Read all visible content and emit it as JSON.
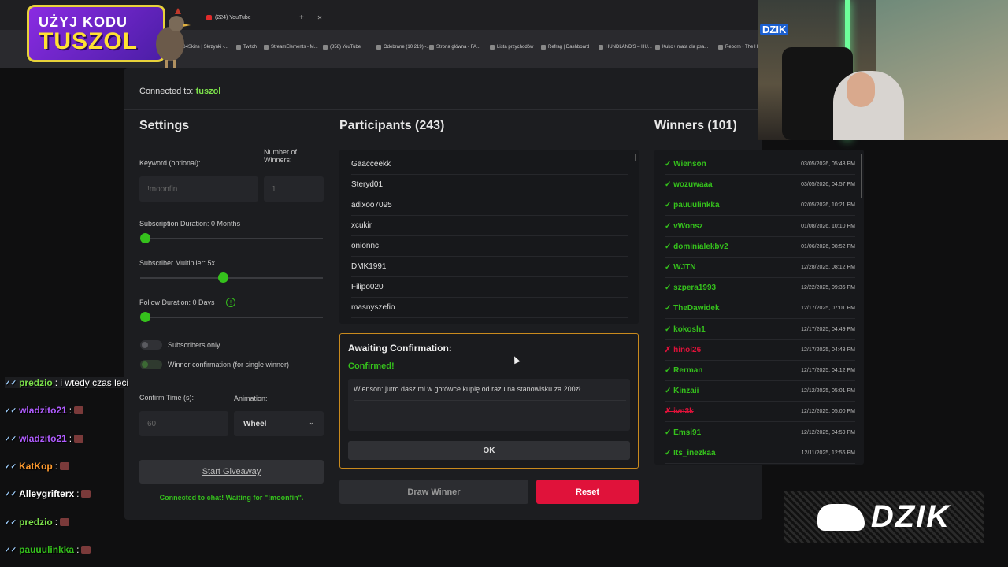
{
  "browser": {
    "tabs": [
      {
        "label": ""
      },
      {
        "label": "(224) YouTube"
      }
    ],
    "new_tab": "+",
    "bookmarks": [
      "G4Skins | Skrzynki -...",
      "Twitch",
      "StreamElements - M...",
      "(358) YouTube",
      "Odebrane (10 219) -...",
      "Strona główna - FA...",
      "Lista przychodów",
      "Refrag | Dashboard",
      "HUNDLAND'S – HU...",
      "Kuko+ mata dla psa...",
      "Reborn • The Ho"
    ]
  },
  "promo": {
    "line1": "UŻYJ KODU",
    "line2": "TUSZOL"
  },
  "app": {
    "connected_prefix": "Connected to:",
    "channel": "tuszol",
    "settings": {
      "title": "Settings",
      "keyword_label": "Keyword (optional):",
      "keyword_value": "!moonfin",
      "winners_label_1": "Number of",
      "winners_label_2": "Winners:",
      "winners_value": "1",
      "sub_duration_label": "Subscription Duration: 0 Months",
      "sub_duration_fraction": 0.0,
      "multiplier_label": "Subscriber Multiplier: 5x",
      "multiplier_fraction": 0.45,
      "follow_label": "Follow Duration: 0 Days",
      "follow_fraction": 0.0,
      "info_icon": "!",
      "subs_only_label": "Subscribers only",
      "winner_confirm_label": "Winner confirmation (for single winner)",
      "confirm_time_label": "Confirm Time (s):",
      "confirm_time_value": "60",
      "animation_label": "Animation:",
      "animation_value": "Wheel",
      "start_button": "Start Giveaway",
      "status": "Connected to chat! Waiting for \"!moonfin\"."
    },
    "participants": {
      "title": "Participants (243)",
      "items": [
        "Gaacceekk",
        "Steryd01",
        "adixoo7095",
        "xcukir",
        "onionnc",
        "DMK1991",
        "Filipo020",
        "masnyszefio"
      ]
    },
    "confirmation": {
      "title": "Awaiting Confirmation:",
      "status": "Confirmed!",
      "message": "Wienson: jutro dasz mi w gotówce kupię od razu na stanowisku za 200zł",
      "ok_button": "OK"
    },
    "draw_button": "Draw Winner",
    "reset_button": "Reset",
    "winners": {
      "title": "Winners (101)",
      "items": [
        {
          "name": "✓ Wienson",
          "date": "03/05/2026, 05:48 PM",
          "rejected": false
        },
        {
          "name": "✓ wozuwaaa",
          "date": "03/05/2026, 04:57 PM",
          "rejected": false
        },
        {
          "name": "✓ pauuulinkka",
          "date": "02/05/2026, 10:21 PM",
          "rejected": false
        },
        {
          "name": "✓ vWonsz",
          "date": "01/08/2026, 10:10 PM",
          "rejected": false
        },
        {
          "name": "✓ dominialekbv2",
          "date": "01/06/2026, 08:52 PM",
          "rejected": false
        },
        {
          "name": "✓ WJTN",
          "date": "12/28/2025, 08:12 PM",
          "rejected": false
        },
        {
          "name": "✓ szpera1993",
          "date": "12/22/2025, 09:36 PM",
          "rejected": false
        },
        {
          "name": "✓ TheDawidek",
          "date": "12/17/2025, 07:01 PM",
          "rejected": false
        },
        {
          "name": "✓ kokosh1",
          "date": "12/17/2025, 04:49 PM",
          "rejected": false
        },
        {
          "name": "✗ hinoi26",
          "date": "12/17/2025, 04:48 PM",
          "rejected": true
        },
        {
          "name": "✓ Rerman",
          "date": "12/17/2025, 04:12 PM",
          "rejected": false
        },
        {
          "name": "✓ Kinzaii",
          "date": "12/12/2025, 05:01 PM",
          "rejected": false
        },
        {
          "name": "✗ ivn3k",
          "date": "12/12/2025, 05:00 PM",
          "rejected": true
        },
        {
          "name": "✓ Emsi91",
          "date": "12/12/2025, 04:59 PM",
          "rejected": false
        },
        {
          "name": "✓ Its_inezkaa",
          "date": "12/11/2025, 12:56 PM",
          "rejected": false
        }
      ]
    }
  },
  "chat": [
    {
      "user": "predzio",
      "text": ": i wtedy czas leci",
      "color": "#7be04a"
    },
    {
      "user": "wladzito21",
      "text": ":",
      "color": "#b05cff"
    },
    {
      "user": "wladzito21",
      "text": ":",
      "color": "#b05cff"
    },
    {
      "user": "KatKop",
      "text": ":",
      "color": "#ff9a2e"
    },
    {
      "user": "Alleygrifterx",
      "text": ":",
      "color": "#ffffff"
    },
    {
      "user": "predzio",
      "text": ":",
      "color": "#7be04a"
    },
    {
      "user": "pauuulinkka",
      "text": ":",
      "color": "#35c11c"
    }
  ],
  "webcam_logo": "DZIK",
  "dzik_logo": "DZIK",
  "colors": {
    "accent_green": "#35c11c",
    "reset_red": "#e0123a",
    "confirm_border": "#c98a1d"
  }
}
